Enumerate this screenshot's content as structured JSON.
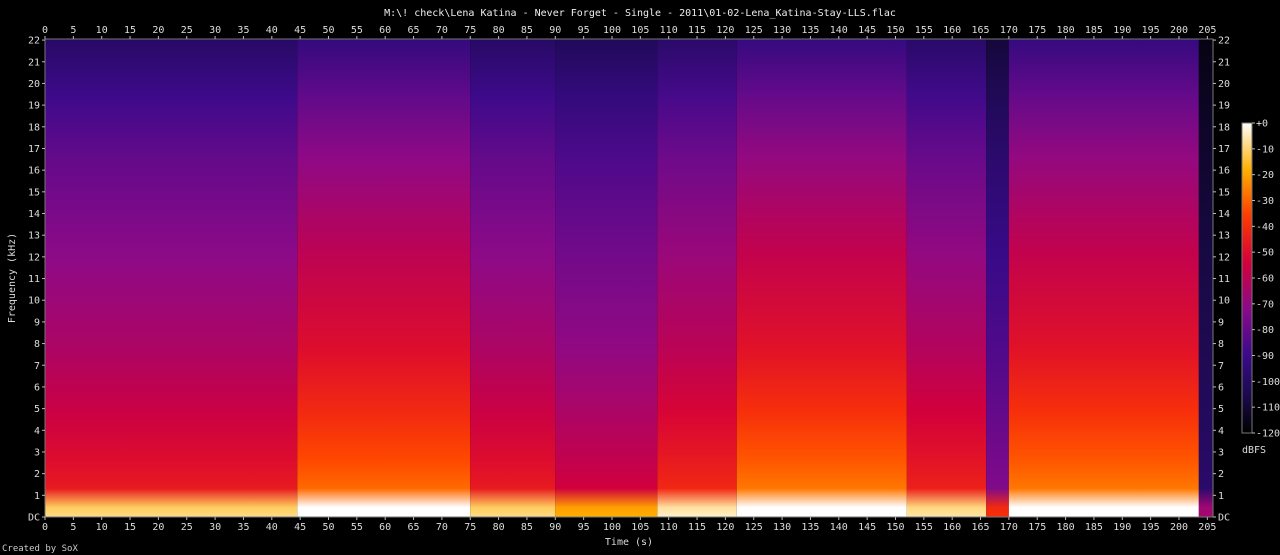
{
  "chart_data": {
    "type": "heatmap",
    "title": "M:\\! check\\Lena Katina - Never Forget - Single - 2011\\01-02-Lena_Katina-Stay-LLS.flac",
    "xlabel": "Time (s)",
    "ylabel": "Frequency (kHz)",
    "xlim": [
      0,
      206
    ],
    "ylim": [
      0,
      22.05
    ],
    "x_ticks": [
      "0",
      "5",
      "10",
      "15",
      "20",
      "25",
      "30",
      "35",
      "40",
      "45",
      "50",
      "55",
      "60",
      "65",
      "70",
      "75",
      "80",
      "85",
      "90",
      "95",
      "100",
      "105",
      "110",
      "115",
      "120",
      "125",
      "130",
      "135",
      "140",
      "145",
      "150",
      "155",
      "160",
      "165",
      "170",
      "175",
      "180",
      "185",
      "190",
      "195",
      "200",
      "205"
    ],
    "y_ticks": [
      "DC",
      "1",
      "2",
      "3",
      "4",
      "5",
      "6",
      "7",
      "8",
      "9",
      "10",
      "11",
      "12",
      "13",
      "14",
      "15",
      "16",
      "17",
      "18",
      "19",
      "20",
      "21",
      "22"
    ],
    "colorbar": {
      "label": "dBFS",
      "ticks": [
        "+0",
        "-10",
        "-20",
        "-30",
        "-40",
        "-50",
        "-60",
        "-70",
        "-80",
        "-90",
        "-100",
        "-110",
        "-120"
      ],
      "range": [
        -120,
        0
      ]
    },
    "sections": [
      {
        "start": 0,
        "end": 44.5,
        "intensity": 0.58
      },
      {
        "start": 44.5,
        "end": 75,
        "intensity": 0.74
      },
      {
        "start": 75,
        "end": 90,
        "intensity": 0.58
      },
      {
        "start": 90,
        "end": 108,
        "intensity": 0.5
      },
      {
        "start": 108,
        "end": 122,
        "intensity": 0.62
      },
      {
        "start": 122,
        "end": 152,
        "intensity": 0.76
      },
      {
        "start": 152,
        "end": 166,
        "intensity": 0.6
      },
      {
        "start": 166,
        "end": 170,
        "intensity": 0.32
      },
      {
        "start": 170,
        "end": 203.5,
        "intensity": 0.76
      },
      {
        "start": 203.5,
        "end": 206,
        "intensity": 0.1
      }
    ],
    "grid": false
  },
  "footer": {
    "credit": "Created by SoX"
  }
}
